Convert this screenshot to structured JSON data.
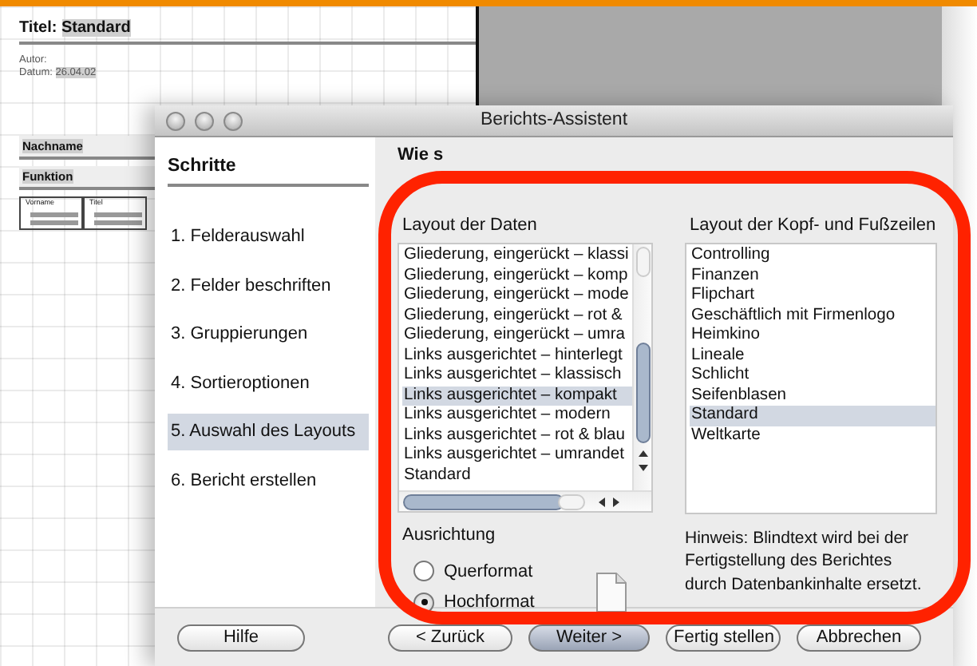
{
  "background_document": {
    "title_label": "Titel:",
    "title_value": "Standard",
    "author_label": "Autor:",
    "date_label": "Datum:",
    "date_value": "26.04.02",
    "fields": [
      "Nachname",
      "Funktion"
    ],
    "table_headers": [
      "Vorname",
      "Titel"
    ]
  },
  "dialog": {
    "title": "Berichts-Assistent",
    "steps_title": "Schritte",
    "steps": [
      {
        "label": "1. Felderauswahl",
        "selected": false
      },
      {
        "label": "2. Felder beschriften",
        "selected": false
      },
      {
        "label": "3. Gruppierungen",
        "selected": false
      },
      {
        "label": "4. Sortieroptionen",
        "selected": false
      },
      {
        "label": "5. Auswahl des Layouts",
        "selected": true
      },
      {
        "label": "6. Bericht erstellen",
        "selected": false
      }
    ],
    "heading": "Wie s",
    "data_layout": {
      "label": "Layout der Daten",
      "items": [
        {
          "label": "Gliederung, eingerückt – klassi",
          "selected": false
        },
        {
          "label": "Gliederung, eingerückt – komp",
          "selected": false
        },
        {
          "label": "Gliederung, eingerückt – mode",
          "selected": false
        },
        {
          "label": "Gliederung, eingerückt – rot &",
          "selected": false
        },
        {
          "label": "Gliederung, eingerückt – umra",
          "selected": false
        },
        {
          "label": "Links ausgerichtet – hinterlegt",
          "selected": false
        },
        {
          "label": "Links ausgerichtet – klassisch",
          "selected": false
        },
        {
          "label": "Links ausgerichtet – kompakt",
          "selected": true
        },
        {
          "label": "Links ausgerichtet – modern",
          "selected": false
        },
        {
          "label": "Links ausgerichtet – rot & blau",
          "selected": false
        },
        {
          "label": "Links ausgerichtet – umrandet",
          "selected": false
        },
        {
          "label": "Standard",
          "selected": false
        }
      ]
    },
    "header_layout": {
      "label": "Layout der Kopf- und Fußzeilen",
      "items": [
        {
          "label": "Controlling",
          "selected": false
        },
        {
          "label": "Finanzen",
          "selected": false
        },
        {
          "label": "Flipchart",
          "selected": false
        },
        {
          "label": "Geschäftlich mit Firmenlogo",
          "selected": false
        },
        {
          "label": "Heimkino",
          "selected": false
        },
        {
          "label": "Lineale",
          "selected": false
        },
        {
          "label": "Schlicht",
          "selected": false
        },
        {
          "label": "Seifenblasen",
          "selected": false
        },
        {
          "label": "Standard",
          "selected": true
        },
        {
          "label": "Weltkarte",
          "selected": false
        }
      ]
    },
    "orientation": {
      "label": "Ausrichtung",
      "options": [
        {
          "label": "Querformat",
          "selected": false
        },
        {
          "label": "Hochformat",
          "selected": true
        }
      ]
    },
    "hint": "Hinweis: Blindtext wird bei der Fertigstellung des Berichtes durch Datenbankinhalte ersetzt.",
    "buttons": [
      {
        "label": "Hilfe",
        "default": false
      },
      {
        "label": "< Zurück",
        "default": false
      },
      {
        "label": "Weiter >",
        "default": true
      },
      {
        "label": "Fertig stellen",
        "default": false
      },
      {
        "label": "Abbrechen",
        "default": false
      }
    ]
  },
  "annotation": {
    "kind": "ring"
  }
}
